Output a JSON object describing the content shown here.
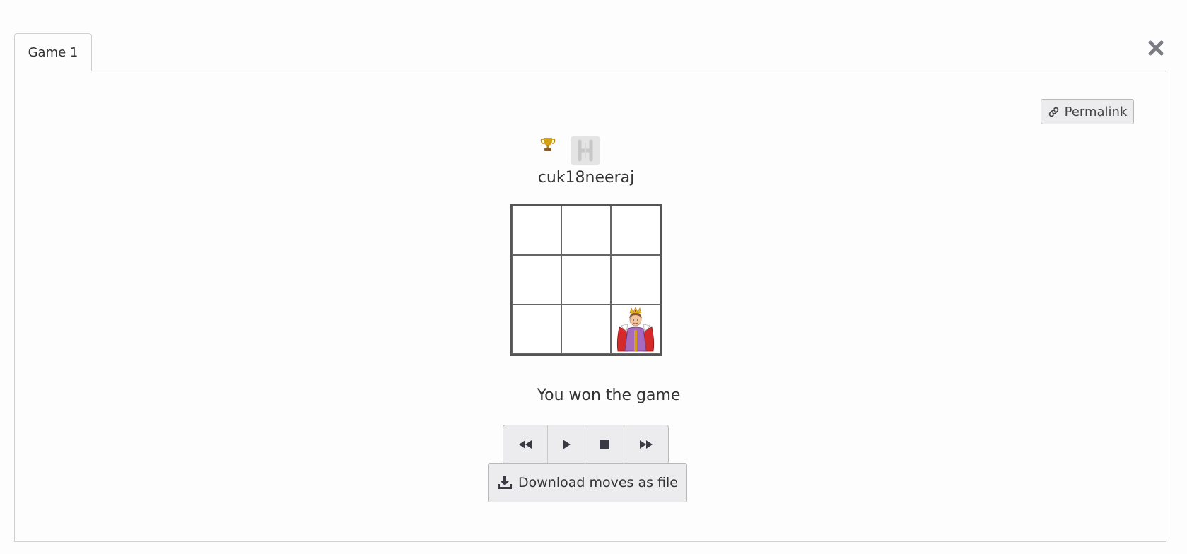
{
  "tabs": [
    {
      "label": "Game 1",
      "active": true
    }
  ],
  "toolbar": {
    "close_icon": "close-icon",
    "permalink_label": "Permalink",
    "permalink_icon": "link-icon"
  },
  "player": {
    "name": "cuk18neeraj",
    "trophy_icon": "trophy-icon",
    "badge_icon": "player-badge-icon"
  },
  "board": {
    "rows": 3,
    "cols": 3,
    "cells": [
      [
        "",
        "",
        ""
      ],
      [
        "",
        "",
        ""
      ],
      [
        "",
        "",
        "queen"
      ]
    ]
  },
  "status": {
    "message": "You won the game"
  },
  "playback": {
    "buttons": [
      {
        "name": "rewind-button",
        "icon": "rewind-icon"
      },
      {
        "name": "play-button",
        "icon": "play-icon"
      },
      {
        "name": "stop-button",
        "icon": "stop-icon"
      },
      {
        "name": "fast-forward-button",
        "icon": "fast-forward-icon"
      }
    ]
  },
  "download": {
    "label": "Download moves as file",
    "icon": "download-icon"
  },
  "colors": {
    "accent": "#ececef",
    "border": "#cfcfcf",
    "text": "#333333",
    "trophy": "#d4a017",
    "queen_robe": "#a66bbf",
    "queen_cape": "#d52a2a"
  }
}
